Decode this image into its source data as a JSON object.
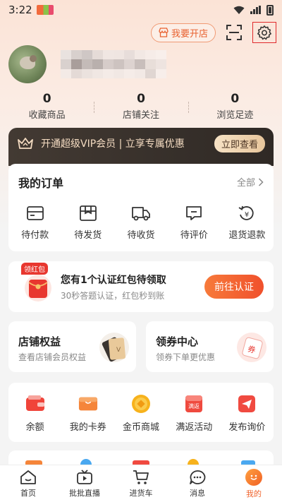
{
  "status_bar": {
    "time": "3:22"
  },
  "header": {
    "open_store_label": "我要开店"
  },
  "profile": {
    "stats": [
      {
        "value": "0",
        "label": "收藏商品"
      },
      {
        "value": "0",
        "label": "店铺关注"
      },
      {
        "value": "0",
        "label": "浏览足迹"
      }
    ]
  },
  "vip_banner": {
    "text": "开通超级VIP会员 | 立享专属优惠",
    "button": "立即查看"
  },
  "orders": {
    "title": "我的订单",
    "all_label": "全部",
    "items": [
      {
        "label": "待付款",
        "icon": "wallet-icon"
      },
      {
        "label": "待发货",
        "icon": "box-icon"
      },
      {
        "label": "待收货",
        "icon": "truck-icon"
      },
      {
        "label": "待评价",
        "icon": "comment-icon"
      },
      {
        "label": "退货退款",
        "icon": "refund-icon"
      }
    ]
  },
  "red_packet": {
    "tag": "领红包",
    "title": "您有1个认证红包待领取",
    "subtitle": "30秒答题认证，红包秒到账",
    "button": "前往认证"
  },
  "shop_rights": {
    "title": "店铺权益",
    "subtitle": "查看店铺会员权益"
  },
  "coupon_center": {
    "title": "领券中心",
    "subtitle": "领券下单更优惠",
    "badge": "券"
  },
  "tools": [
    {
      "label": "余额",
      "icon": "wallet-red-icon",
      "color": "#f0443a"
    },
    {
      "label": "我的卡券",
      "icon": "card-coupon-icon",
      "color": "#f5853a"
    },
    {
      "label": "金币商城",
      "icon": "coin-icon",
      "color": "#f7b21c"
    },
    {
      "label": "满返活动",
      "icon": "full-return-icon",
      "color": "#ef4a3e",
      "text": "满返"
    },
    {
      "label": "发布询价",
      "icon": "send-inquiry-icon",
      "color": "#f04a40"
    }
  ],
  "tabbar": [
    {
      "label": "首页",
      "icon": "home-icon"
    },
    {
      "label": "批批直播",
      "icon": "live-tv-icon"
    },
    {
      "label": "进货车",
      "icon": "cart-icon"
    },
    {
      "label": "消息",
      "icon": "message-icon"
    },
    {
      "label": "我的",
      "icon": "me-icon",
      "active": true
    }
  ],
  "colors": {
    "accent": "#f0642d",
    "vip_bg": "#3a322c",
    "vip_text": "#f5dcc2"
  }
}
